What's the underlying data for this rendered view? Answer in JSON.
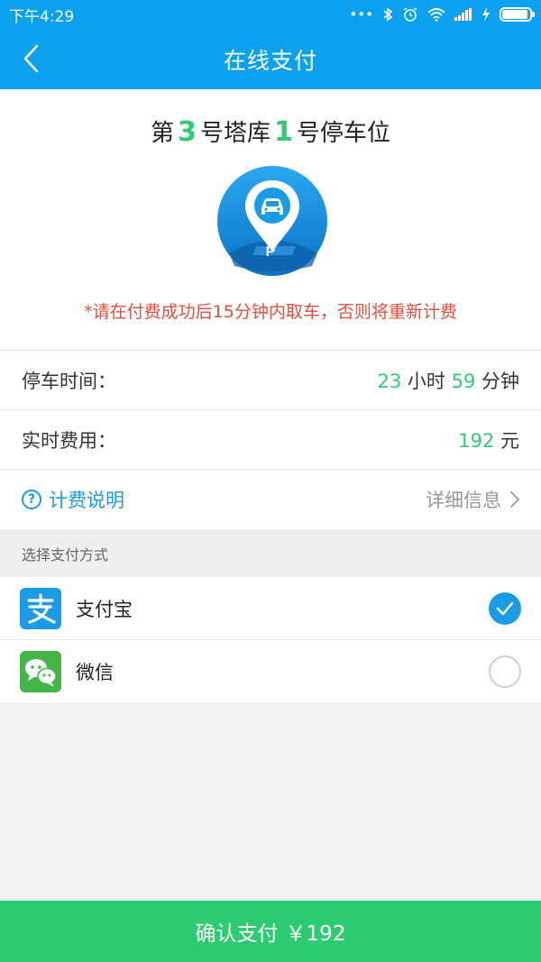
{
  "status_bar": {
    "time": "下午4:29"
  },
  "header": {
    "title": "在线支付"
  },
  "slot": {
    "prefix": "第",
    "tower_number": "3",
    "middle": "号塔库",
    "space_number": "1",
    "suffix": "号停车位"
  },
  "warning": "*请在付费成功后15分钟内取车，否则将重新计费",
  "parking": {
    "time_label": "停车时间：",
    "hours": "23",
    "hours_unit": "小时",
    "minutes": "59",
    "minutes_unit": "分钟",
    "fee_label": "实时费用：",
    "fee": "192",
    "fee_unit": "元"
  },
  "help": {
    "label": "计费说明",
    "detail": "详细信息"
  },
  "payment": {
    "header": "选择支付方式",
    "methods": [
      {
        "label": "支付宝",
        "selected": true,
        "icon": "alipay-icon",
        "color": "#1a9be6"
      },
      {
        "label": "微信",
        "selected": false,
        "icon": "wechat-icon",
        "color": "#44b549"
      }
    ]
  },
  "confirm": {
    "label": "确认支付",
    "amount": "￥192"
  },
  "colors": {
    "primary": "#0ca1ee",
    "green": "#2ecc71",
    "warning": "#e74c3c"
  }
}
